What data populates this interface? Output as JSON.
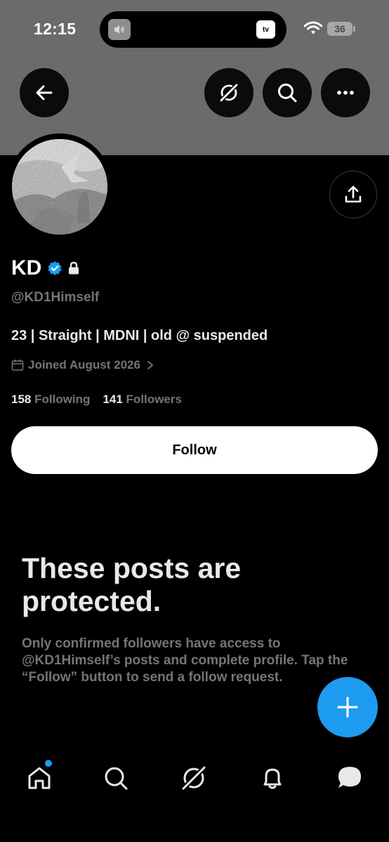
{
  "status_bar": {
    "time": "12:15",
    "battery": "36",
    "island_app": "tv"
  },
  "profile": {
    "name": "KD",
    "handle": "@KD1Himself",
    "bio": "23 | Straight | MDNI | old @ suspended",
    "joined": "Joined August 2026",
    "following_count": "158",
    "following_label": "Following",
    "followers_count": "141",
    "followers_label": "Followers",
    "verified_color": "#1d9bf0"
  },
  "actions": {
    "follow_label": "Follow"
  },
  "protected": {
    "title": "These posts are protected.",
    "description": "Only confirmed followers have access to @KD1Himself’s posts and complete profile. Tap the “Follow” button to send a follow request."
  },
  "icons": {
    "header": [
      "back-arrow-icon",
      "grok-icon",
      "search-icon",
      "more-icon"
    ],
    "tabs": [
      "home-icon",
      "search-icon",
      "grok-icon",
      "notifications-icon",
      "messages-icon"
    ]
  },
  "colors": {
    "accent": "#1d9bf0",
    "background": "#000000",
    "banner": "#6b6b6b"
  }
}
